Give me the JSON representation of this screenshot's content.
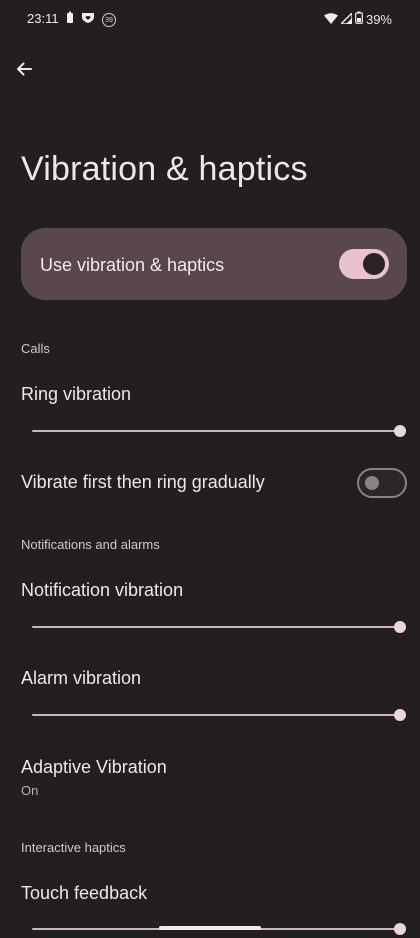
{
  "status_bar": {
    "time": "23:11",
    "badge": "39",
    "battery": "39%"
  },
  "page": {
    "title": "Vibration & haptics"
  },
  "main_toggle": {
    "label": "Use vibration & haptics",
    "checked": true
  },
  "sections": {
    "calls": "Calls",
    "notifications": "Notifications and alarms",
    "interactive": "Interactive haptics"
  },
  "items": {
    "ring": {
      "label": "Ring vibration",
      "level": 1.0
    },
    "vibrate_first": {
      "label": "Vibrate first then ring gradually",
      "checked": false
    },
    "notification": {
      "label": "Notification vibration",
      "level": 1.0
    },
    "alarm": {
      "label": "Alarm vibration",
      "level": 1.0
    },
    "adaptive": {
      "label": "Adaptive Vibration",
      "summary": "On"
    },
    "touch": {
      "label": "Touch feedback",
      "level": 1.0
    }
  },
  "colors": {
    "background": "#231f21",
    "card": "#5a474d",
    "accent": "#e9c1cf"
  }
}
